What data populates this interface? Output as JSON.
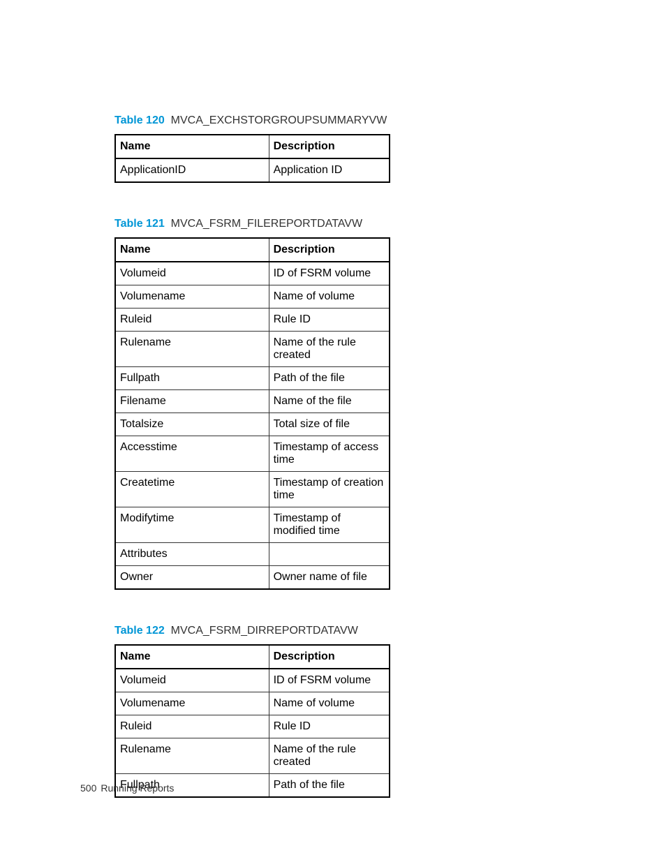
{
  "tables": [
    {
      "number": "Table 120",
      "title": "MVCA_EXCHSTORGROUPSUMMARYVW",
      "headers": [
        "Name",
        "Description"
      ],
      "rows": [
        [
          "ApplicationID",
          "Application ID"
        ]
      ]
    },
    {
      "number": "Table 121",
      "title": "MVCA_FSRM_FILEREPORTDATAVW",
      "headers": [
        "Name",
        "Description"
      ],
      "rows": [
        [
          "Volumeid",
          "ID of FSRM volume"
        ],
        [
          "Volumename",
          "Name of volume"
        ],
        [
          "Ruleid",
          "Rule ID"
        ],
        [
          "Rulename",
          "Name of the rule created"
        ],
        [
          "Fullpath",
          "Path of the file"
        ],
        [
          "Filename",
          "Name of the file"
        ],
        [
          "Totalsize",
          "Total size of file"
        ],
        [
          "Accesstime",
          "Timestamp of access time"
        ],
        [
          "Createtime",
          "Timestamp of creation time"
        ],
        [
          "Modifytime",
          "Timestamp of modified time"
        ],
        [
          "Attributes",
          ""
        ],
        [
          "Owner",
          "Owner name of file"
        ]
      ]
    },
    {
      "number": "Table 122",
      "title": "MVCA_FSRM_DIRREPORTDATAVW",
      "headers": [
        "Name",
        "Description"
      ],
      "rows": [
        [
          "Volumeid",
          "ID of FSRM volume"
        ],
        [
          "Volumename",
          "Name of volume"
        ],
        [
          "Ruleid",
          "Rule ID"
        ],
        [
          "Rulename",
          "Name of the rule created"
        ],
        [
          "Fullpath",
          "Path of the file"
        ]
      ]
    }
  ],
  "footer": {
    "page_number": "500",
    "section": "Running Reports"
  }
}
